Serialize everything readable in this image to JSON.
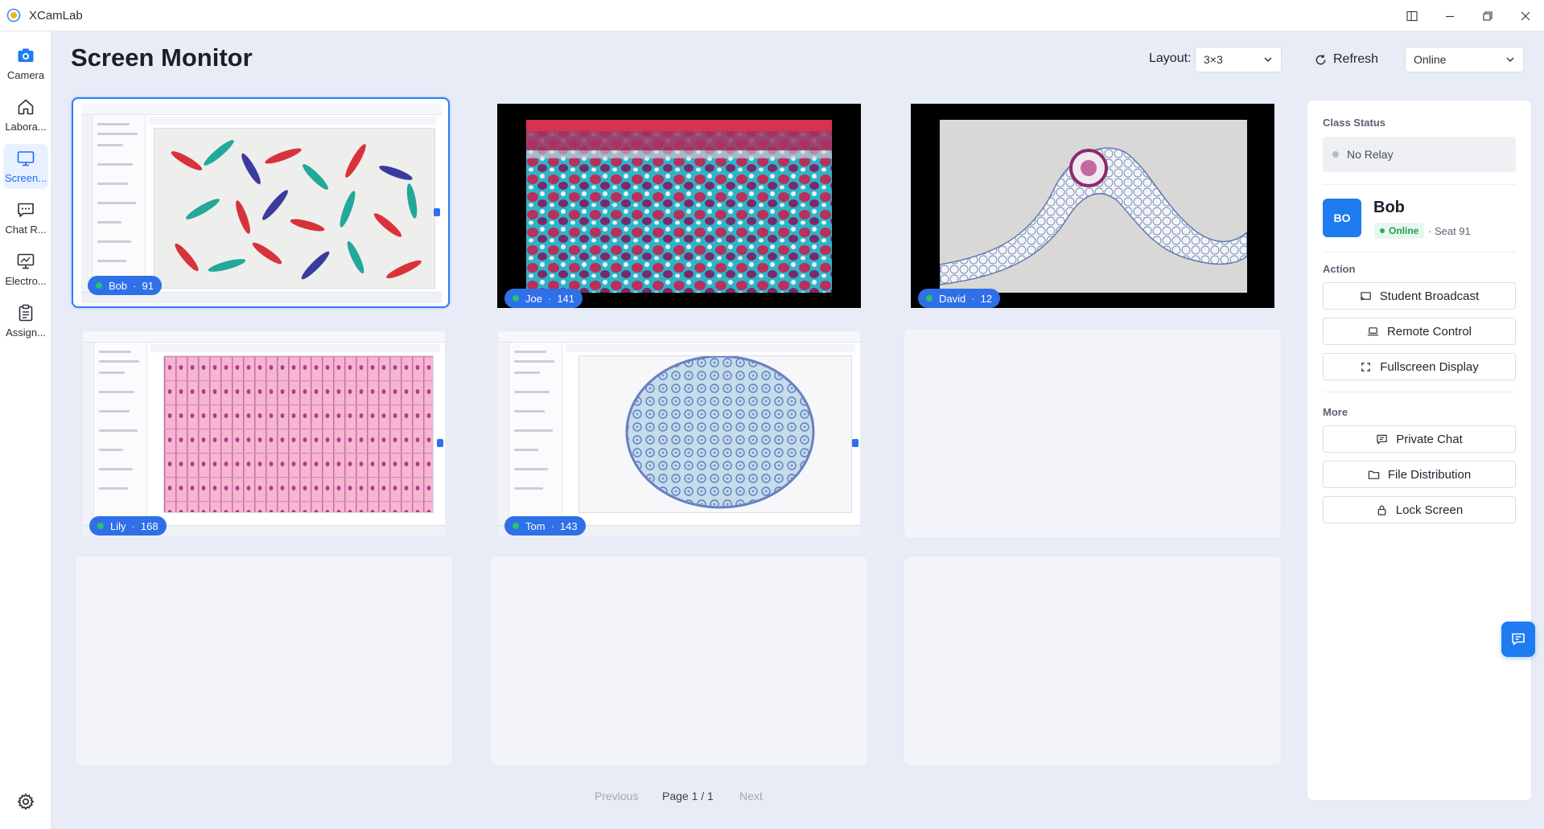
{
  "app": {
    "title": "XCamLab"
  },
  "sidebar": {
    "items": [
      {
        "label": "Camera",
        "icon": "camera-icon"
      },
      {
        "label": "Labora...",
        "icon": "home-icon"
      },
      {
        "label": "Screen...",
        "icon": "monitor-icon"
      },
      {
        "label": "Chat R...",
        "icon": "chat-icon"
      },
      {
        "label": "Electro...",
        "icon": "whiteboard-icon"
      },
      {
        "label": "Assign...",
        "icon": "clipboard-icon"
      }
    ],
    "active": "Screen..."
  },
  "header": {
    "title": "Screen Monitor",
    "layout_label": "Layout:",
    "layout_value": "3×3",
    "refresh_label": "Refresh",
    "filter_value": "Online"
  },
  "tiles": [
    {
      "name": "Bob",
      "seat": "91",
      "selected": true
    },
    {
      "name": "Joe",
      "seat": "141"
    },
    {
      "name": "David",
      "seat": "12"
    },
    {
      "name": "Lily",
      "seat": "168"
    },
    {
      "name": "Tom",
      "seat": "143"
    }
  ],
  "right_panel": {
    "class_status_title": "Class Status",
    "relay_status": "No Relay",
    "student": {
      "initials": "BO",
      "name": "Bob",
      "status": "Online",
      "seat": "Seat 91"
    },
    "action_title": "Action",
    "actions": [
      "Student Broadcast",
      "Remote Control",
      "Fullscreen Display"
    ],
    "more_title": "More",
    "more": [
      "Private Chat",
      "File Distribution",
      "Lock Screen"
    ]
  },
  "pagination": {
    "previous": "Previous",
    "page": "Page 1 / 1",
    "next": "Next"
  },
  "colors": {
    "accent": "#1e7bf0",
    "online": "#22b05a"
  }
}
